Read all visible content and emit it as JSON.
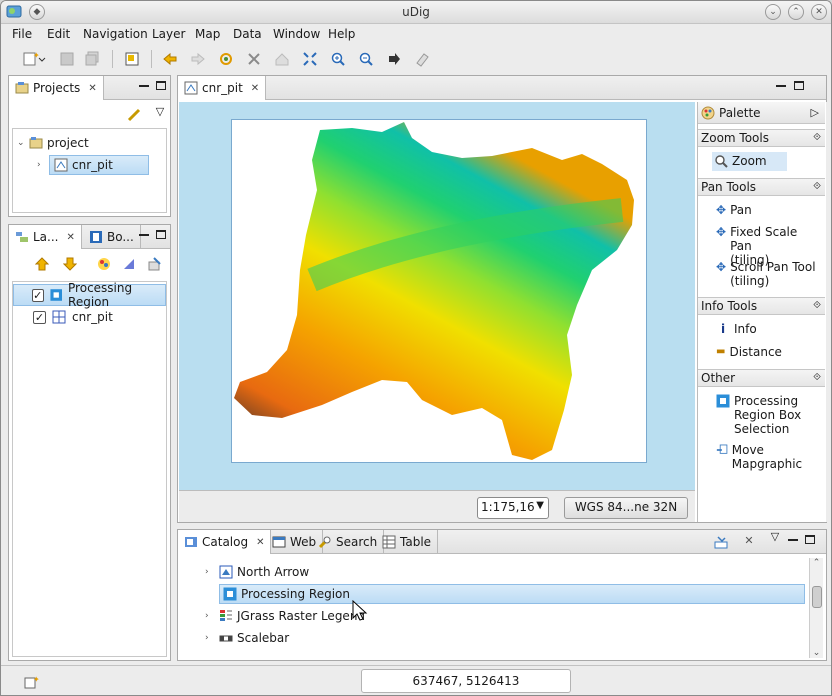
{
  "window": {
    "title": "uDig"
  },
  "menu": [
    "File",
    "Edit",
    "Navigation",
    "Layer",
    "Map",
    "Data",
    "Window",
    "Help"
  ],
  "projects_panel": {
    "tab": "Projects",
    "tree": [
      {
        "label": "project"
      },
      {
        "label": "cnr_pit"
      }
    ]
  },
  "layers_panel": {
    "tabs": [
      "La...",
      "Bo..."
    ],
    "layers": [
      {
        "label": "Processing Region",
        "checked": true
      },
      {
        "label": "cnr_pit",
        "checked": true
      }
    ]
  },
  "map_editor": {
    "tab": "cnr_pit",
    "scale": "1:175,16",
    "crs": "WGS 84...ne 32N"
  },
  "palette": {
    "title": "Palette",
    "sections": [
      {
        "label": "Zoom Tools",
        "items": [
          "Zoom"
        ]
      },
      {
        "label": "Pan Tools",
        "items": [
          "Pan",
          "Fixed Scale Pan\n(tiling)",
          "Scroll Pan Tool\n(tiling)"
        ]
      },
      {
        "label": "Info Tools",
        "items": [
          "Info",
          "Distance"
        ]
      },
      {
        "label": "Other",
        "items": [
          "Processing\nRegion Box\nSelection",
          "Move Mapgraphic"
        ]
      }
    ]
  },
  "catalog": {
    "tabs": [
      "Catalog",
      "Web",
      "Search",
      "Table"
    ],
    "items": [
      "North Arrow",
      "Processing Region",
      "JGrass Raster Legend",
      "Scalebar"
    ]
  },
  "status": {
    "coordinates": "637467, 5126413"
  }
}
